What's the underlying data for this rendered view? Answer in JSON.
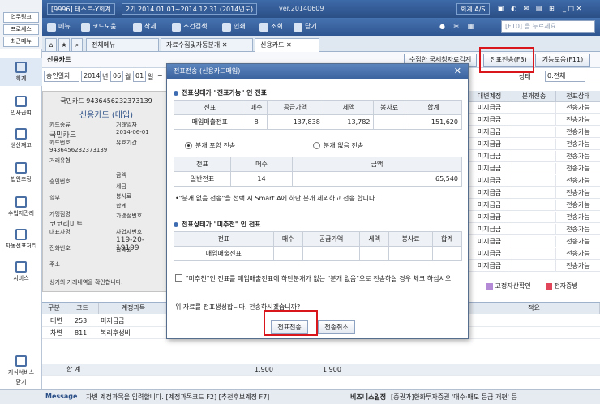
{
  "window": {
    "company": "[9996] 테스트-Y회계",
    "period": "2기 2014.01.01~2014.12.31 (2014년도)",
    "version": "ver.20140609",
    "right_label": "회계 A/S"
  },
  "left_menu": [
    "업무링크",
    "프로세스",
    "최근메뉴"
  ],
  "toolbar": {
    "menu": "메뉴",
    "code_help": "코드도움",
    "delete": "삭제",
    "search_condition": "조건검색",
    "print": "인쇄",
    "inquiry": "조회",
    "close": "닫기",
    "search_placeholder": "[F10] 을 누르세요"
  },
  "sidebar": [
    "회계",
    "인사급여",
    "생산재고",
    "법인조정",
    "수입지관리",
    "자동전표처리",
    "서비스",
    "지식서비스",
    "닫기"
  ],
  "tabs": [
    "전체메뉴",
    "자료수집및자동분개",
    "신용카드"
  ],
  "page": {
    "title": "신용카드",
    "btn_national_tax": "수집한 국세청자료검계",
    "btn_transfer": "전표전송(F3)",
    "btn_functions": "기능모음(F11)"
  },
  "filter": {
    "date_type": "승인일자",
    "year": "2014",
    "year_unit": "년",
    "month": "06",
    "month_unit": "월",
    "day": "01",
    "day_unit": "일",
    "dash": "~",
    "year2": "2014",
    "status_label": "상태",
    "status_value": "0.전체"
  },
  "card": {
    "company": "국민카드 9436456232373139",
    "title": "신용카드 (매입)",
    "labels": [
      "카드종류",
      "국민카드",
      "카드번호",
      "9436456232373139",
      "거래유형",
      "",
      "승인번호",
      "",
      "할부",
      "",
      "가맹점명",
      "코코리미트",
      "대표자명",
      "",
      "전화번호",
      "",
      "주소",
      ""
    ],
    "right_labels": [
      "거래일자",
      "2014-06-01",
      "유효기간",
      "",
      "금액",
      "세금",
      "봉사료",
      "합계",
      "가맹점번호",
      "사업자번호",
      "119-20-19199",
      "판매원"
    ],
    "footer": "상기의 거래내역을 확인합니다."
  },
  "right_grid": {
    "headers": [
      "대변계정",
      "분개전송",
      "전표상태"
    ],
    "rows": [
      [
        "미지급금",
        "",
        "전송가능"
      ],
      [
        "미지급금",
        "",
        "전송가능"
      ],
      [
        "미지급금",
        "",
        "전송가능"
      ],
      [
        "미지급금",
        "",
        "전송가능"
      ],
      [
        "미지급금",
        "",
        "전송가능"
      ],
      [
        "미지급금",
        "",
        "전송가능"
      ],
      [
        "미지급금",
        "",
        "전송가능"
      ],
      [
        "미지급금",
        "",
        "전송가능"
      ],
      [
        "미지급금",
        "",
        "전송가능"
      ],
      [
        "미지급금",
        "",
        "전송가능"
      ],
      [
        "미지급금",
        "",
        "전송가능"
      ],
      [
        "미지급금",
        "",
        "전송가능"
      ],
      [
        "미지급금",
        "",
        "전송가능"
      ],
      [
        "미지급금",
        "",
        "전송가능"
      ]
    ],
    "legend": [
      "고정자산확인",
      "전자증빙"
    ]
  },
  "bottom_grid": {
    "headers": [
      "구분",
      "코드",
      "계정과목",
      "",
      "",
      "적요"
    ],
    "rows": [
      {
        "type": "대변",
        "code": "253",
        "name": "미지급금"
      },
      {
        "type": "차변",
        "code": "811",
        "name": "복리후생비"
      }
    ],
    "total_label": "합    계",
    "total_debit": "1,900",
    "total_credit": "1,900"
  },
  "dialog": {
    "title": "전표전송 (신용카드매입)",
    "section1": "전표상태가 \"전표가능\" 인 전표",
    "table1_headers": [
      "전표",
      "매수",
      "공급가액",
      "세액",
      "봉사료",
      "합계"
    ],
    "table1_row": [
      "매입매출전표",
      "8",
      "137,838",
      "13,782",
      "",
      "151,620"
    ],
    "radio_include": "분개 포함 전송",
    "radio_exclude": "분개 없음 전송",
    "table2_headers": [
      "전표",
      "매수",
      "금액"
    ],
    "table2_row": [
      "일반전표",
      "14",
      "65,540"
    ],
    "note1": "•\"분개 없음 전송\"을 선택 시 Smart A에 하단 분개 제외하고 전송 합니다.",
    "section2": "전표상태가 \"미추천\" 인 전표",
    "table3_headers": [
      "전표",
      "매수",
      "공급가액",
      "세액",
      "봉사료",
      "합계"
    ],
    "table3_row": [
      "매입매출전표",
      "",
      "",
      "",
      "",
      ""
    ],
    "check_note": "\"미추천\"인 전표를 매입매출전표에 하단분개가 없는 \"분개 없음\"으로 전송하실 경우 체크 하십시오.",
    "confirm_text": "위 자료를 전표생성합니다. 전송하시겠습니까?",
    "btn_send": "전표전송",
    "btn_cancel": "전송취소"
  },
  "statusbar": {
    "message_label": "Message",
    "message": "차변 계정과목을 입력합니다. [계정과목코드 F2] [추천후보계정 F7]",
    "business_label": "비즈니스일정",
    "business_text": "[증권가]한화투자증권 '매수·매도 등급 개편' 등"
  },
  "colors": {
    "accent": "#2b4f86",
    "highlight": "#d9161b"
  }
}
